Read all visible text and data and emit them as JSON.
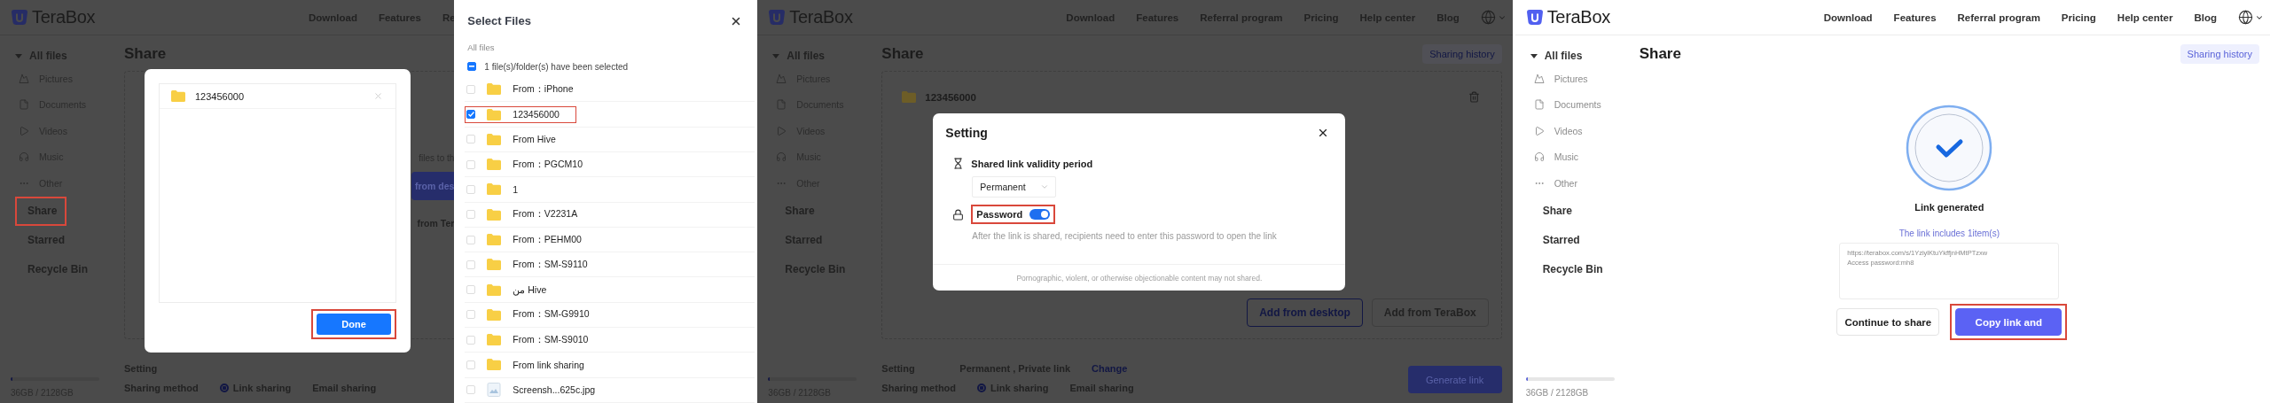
{
  "select_screen": {
    "header": {
      "logo": "TeraBox",
      "nav": [
        "Download",
        "Features",
        "Re"
      ],
      "language_menu": false
    },
    "sidebar": {
      "tree": {
        "label": "All files",
        "expanded": true
      },
      "categories": [
        {
          "label": "Pictures",
          "kind": "picture"
        },
        {
          "label": "Documents",
          "kind": "document"
        },
        {
          "label": "Videos",
          "kind": "video"
        },
        {
          "label": "Music",
          "kind": "music"
        },
        {
          "label": "Other",
          "kind": "other"
        }
      ],
      "links": [
        {
          "label": "Share",
          "highlighted": true
        },
        {
          "label": "Starred",
          "highlighted": false
        },
        {
          "label": "Recycle Bin",
          "highlighted": false
        }
      ],
      "storage": {
        "level": 0.02,
        "text": "36GB / 2128GB"
      }
    },
    "title": "Share",
    "behind": {
      "hint": "files to th",
      "buttons": [
        {
          "label": "from des",
          "primary": true
        },
        {
          "label": "from Ter",
          "primary": false
        }
      ]
    },
    "setting": {
      "label": "Setting"
    },
    "sharing": {
      "label": "Sharing method",
      "options": [
        {
          "label": "Link sharing",
          "selected": true
        },
        {
          "label": "Email sharing",
          "selected": false
        }
      ]
    },
    "done_dialog": {
      "files": [
        {
          "name": "123456000",
          "kind": "folder"
        }
      ],
      "button": {
        "label": "Done",
        "highlighted": true
      }
    },
    "drawer": {
      "title": "Select Files",
      "path": "All files",
      "select_all": {
        "checked": true,
        "indeterminate": true
      },
      "summary": "1 file(s)/folder(s) have been selected",
      "rows": [
        {
          "name": "From：iPhone",
          "kind": "folder",
          "selected": false,
          "highlighted": false
        },
        {
          "name": "123456000",
          "kind": "folder",
          "selected": true,
          "highlighted": true
        },
        {
          "name": "From Hive",
          "kind": "folder",
          "selected": false,
          "highlighted": false
        },
        {
          "name": "From：PGCM10",
          "kind": "folder",
          "selected": false,
          "highlighted": false
        },
        {
          "name": "1",
          "kind": "folder",
          "selected": false,
          "highlighted": false
        },
        {
          "name": "From：V2231A",
          "kind": "folder",
          "selected": false,
          "highlighted": false
        },
        {
          "name": "From：PEHM00",
          "kind": "folder",
          "selected": false,
          "highlighted": false
        },
        {
          "name": "From：SM-S9110",
          "kind": "folder",
          "selected": false,
          "highlighted": false
        },
        {
          "name": "من Hive",
          "kind": "folder",
          "selected": false,
          "highlighted": false
        },
        {
          "name": "From：SM-G9910",
          "kind": "folder",
          "selected": false,
          "highlighted": false
        },
        {
          "name": "From：SM-S9010",
          "kind": "folder",
          "selected": false,
          "highlighted": false
        },
        {
          "name": "From link sharing",
          "kind": "folder",
          "selected": false,
          "highlighted": false
        },
        {
          "name": "Screensh...625c.jpg",
          "kind": "image",
          "selected": false,
          "highlighted": false
        }
      ]
    }
  },
  "setting_screen": {
    "header": {
      "logo": "TeraBox",
      "nav": [
        "Download",
        "Features",
        "Referral program",
        "Pricing",
        "Help center",
        "Blog"
      ],
      "language_menu": true
    },
    "sidebar": {
      "tree": {
        "label": "All files",
        "expanded": true
      },
      "categories": [
        {
          "label": "Pictures",
          "kind": "picture"
        },
        {
          "label": "Documents",
          "kind": "document"
        },
        {
          "label": "Videos",
          "kind": "video"
        },
        {
          "label": "Music",
          "kind": "music"
        },
        {
          "label": "Other",
          "kind": "other"
        }
      ],
      "links": [
        {
          "label": "Share",
          "highlighted": false
        },
        {
          "label": "Starred",
          "highlighted": false
        },
        {
          "label": "Recycle Bin",
          "highlighted": false
        }
      ],
      "storage": {
        "level": 0.02,
        "text": "36GB / 2128GB"
      }
    },
    "title": "Share",
    "history_button": "Sharing history",
    "files": [
      {
        "name": "123456000",
        "kind": "folder"
      }
    ],
    "add_buttons": [
      {
        "label": "Add from desktop",
        "primary": true
      },
      {
        "label": "Add from TeraBox",
        "primary": false
      }
    ],
    "setting": {
      "label": "Setting",
      "value": "Permanent , Private link",
      "link": "Change"
    },
    "sharing": {
      "label": "Sharing method",
      "options": [
        {
          "label": "Link sharing",
          "selected": true
        },
        {
          "label": "Email sharing",
          "selected": false
        }
      ]
    },
    "generate_button": "Generate link",
    "dialog": {
      "title": "Setting",
      "validity": {
        "label": "Shared link validity period",
        "value": "Permanent"
      },
      "password": {
        "label": "Password",
        "on": true,
        "highlighted": true,
        "hint": "After the link is shared, recipients need to enter this password to open the link"
      },
      "footer": "Pornographic, violent, or otherwise objectionable content may not shared."
    }
  },
  "link_screen": {
    "header": {
      "logo": "TeraBox",
      "nav": [
        "Download",
        "Features",
        "Referral program",
        "Pricing",
        "Help center",
        "Blog"
      ],
      "language_menu": true
    },
    "sidebar": {
      "tree": {
        "label": "All files",
        "expanded": true
      },
      "categories": [
        {
          "label": "Pictures",
          "kind": "picture"
        },
        {
          "label": "Documents",
          "kind": "document"
        },
        {
          "label": "Videos",
          "kind": "video"
        },
        {
          "label": "Music",
          "kind": "music"
        },
        {
          "label": "Other",
          "kind": "other"
        }
      ],
      "links": [
        {
          "label": "Share",
          "highlighted": false
        },
        {
          "label": "Starred",
          "highlighted": false
        },
        {
          "label": "Recycle Bin",
          "highlighted": false
        }
      ],
      "storage": {
        "level": 0.02,
        "text": "36GB / 2128GB"
      }
    },
    "title": "Share",
    "history_button": "Sharing history",
    "status": "Link generated",
    "count": "The link includes 1item(s)",
    "link_text": [
      "https://terabox.com/s/1YziylKtuYkffjnHMtPTzxw",
      "Access password:mh8"
    ],
    "buttons": [
      {
        "label": "Continue to share",
        "primary": false,
        "highlighted": false
      },
      {
        "label": "Copy link and",
        "primary": true,
        "highlighted": true
      }
    ]
  }
}
